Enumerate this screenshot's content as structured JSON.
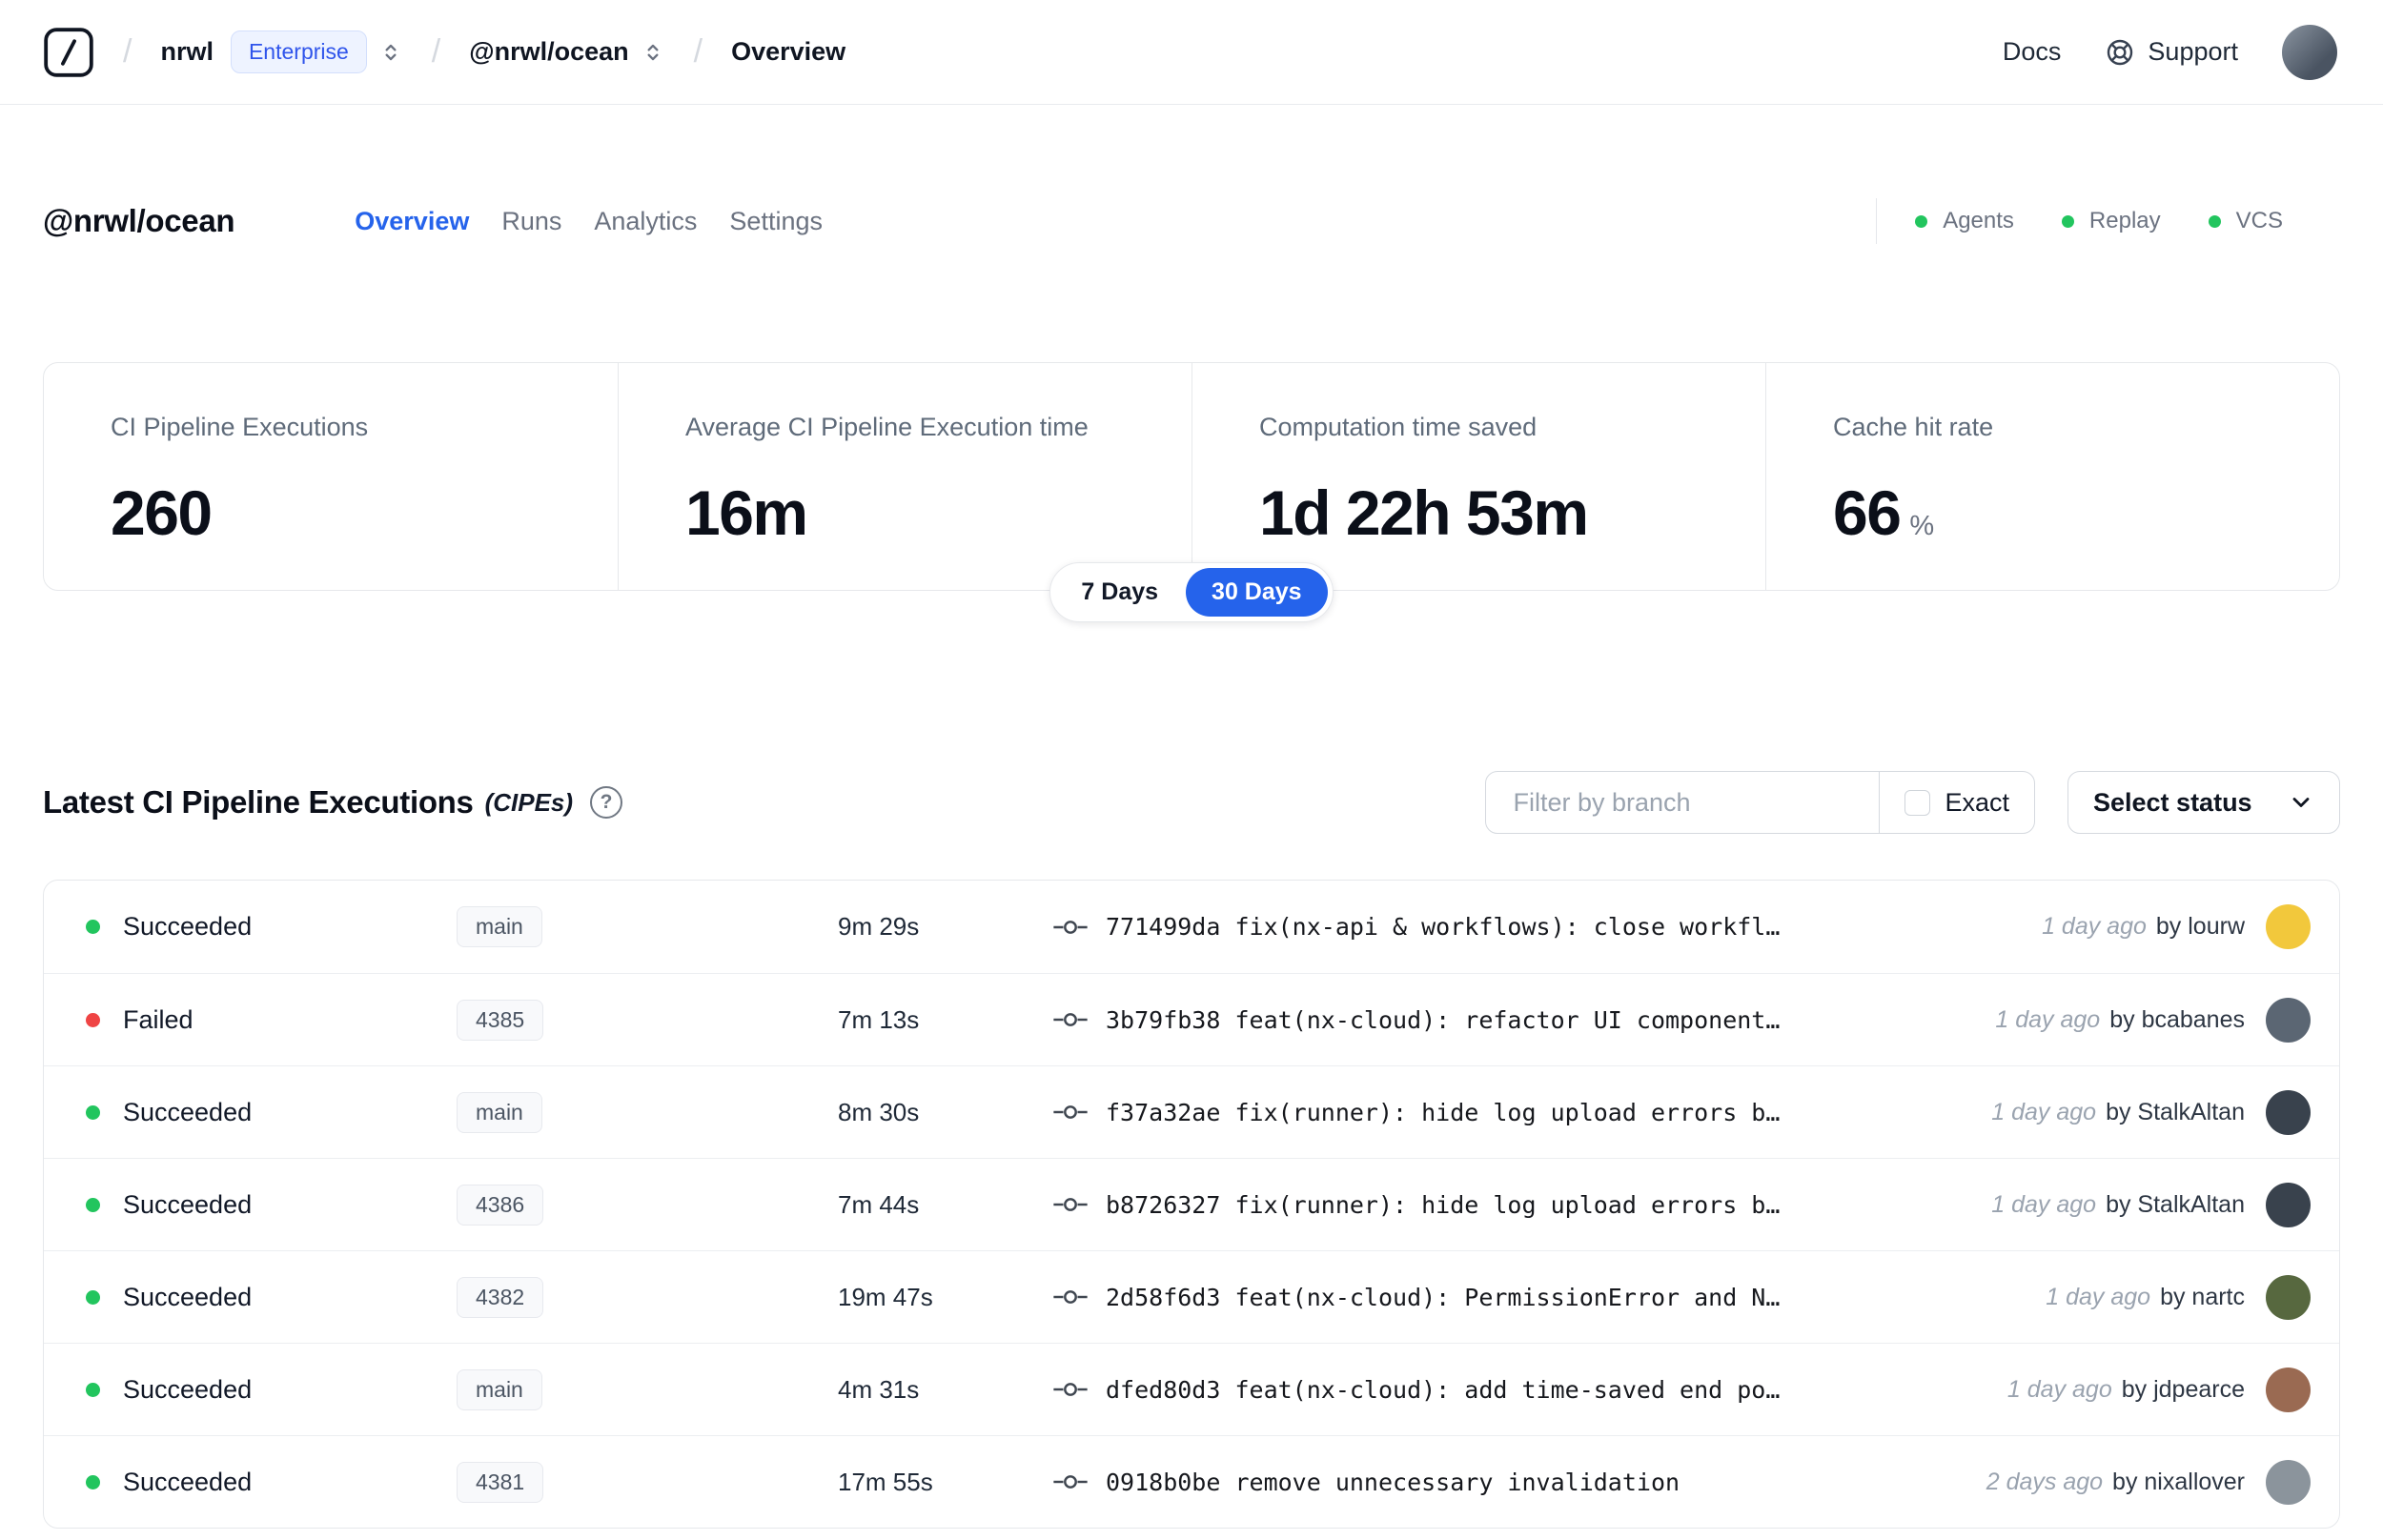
{
  "navbar": {
    "breadcrumb": {
      "org": "nrwl",
      "org_badge": "Enterprise",
      "workspace": "@nrwl/ocean",
      "page": "Overview"
    },
    "docs_label": "Docs",
    "support_label": "Support"
  },
  "header": {
    "title": "@nrwl/ocean",
    "tabs": [
      {
        "label": "Overview",
        "active": true
      },
      {
        "label": "Runs",
        "active": false
      },
      {
        "label": "Analytics",
        "active": false
      },
      {
        "label": "Settings",
        "active": false
      }
    ],
    "legend": [
      {
        "label": "Agents"
      },
      {
        "label": "Replay"
      },
      {
        "label": "VCS"
      }
    ],
    "legend_dot_color": "#22c55e"
  },
  "stats": {
    "cards": [
      {
        "label": "CI Pipeline Executions",
        "value": "260",
        "suffix": ""
      },
      {
        "label": "Average CI Pipeline Execution time",
        "value": "16m",
        "suffix": ""
      },
      {
        "label": "Computation time saved",
        "value": "1d 22h 53m",
        "suffix": ""
      },
      {
        "label": "Cache hit rate",
        "value": "66",
        "suffix": "%"
      }
    ],
    "range_toggle": [
      {
        "label": "7 Days",
        "active": false
      },
      {
        "label": "30 Days",
        "active": true
      }
    ],
    "accent_color": "#2563eb"
  },
  "cipes": {
    "title": "Latest CI Pipeline Executions",
    "title_suffix": "(CIPEs)",
    "help_glyph": "?",
    "filter_placeholder": "Filter by branch",
    "exact_label": "Exact",
    "status_select_label": "Select status",
    "rows": [
      {
        "status": "Succeeded",
        "status_color": "#22c55e",
        "branch": "main",
        "duration": "9m 29s",
        "commit": "771499da fix(nx-api & workflows): close workfl…",
        "time": "1 day ago",
        "author": "by lourw",
        "avatar_color": "#f2c83c"
      },
      {
        "status": "Failed",
        "status_color": "#ef4444",
        "branch": "4385",
        "duration": "7m 13s",
        "commit": "3b79fb38 feat(nx-cloud): refactor UI component…",
        "time": "1 day ago",
        "author": "by bcabanes",
        "avatar_color": "#5b6673"
      },
      {
        "status": "Succeeded",
        "status_color": "#22c55e",
        "branch": "main",
        "duration": "8m 30s",
        "commit": "f37a32ae fix(runner): hide log upload errors b…",
        "time": "1 day ago",
        "author": "by StalkAltan",
        "avatar_color": "#39424d"
      },
      {
        "status": "Succeeded",
        "status_color": "#22c55e",
        "branch": "4386",
        "duration": "7m 44s",
        "commit": "b8726327 fix(runner): hide log upload errors b…",
        "time": "1 day ago",
        "author": "by StalkAltan",
        "avatar_color": "#39424d"
      },
      {
        "status": "Succeeded",
        "status_color": "#22c55e",
        "branch": "4382",
        "duration": "19m 47s",
        "commit": "2d58f6d3 feat(nx-cloud): PermissionError and N…",
        "time": "1 day ago",
        "author": "by nartc",
        "avatar_color": "#57683f"
      },
      {
        "status": "Succeeded",
        "status_color": "#22c55e",
        "branch": "main",
        "duration": "4m 31s",
        "commit": "dfed80d3 feat(nx-cloud): add time-saved end po…",
        "time": "1 day ago",
        "author": "by jdpearce",
        "avatar_color": "#9a6a52"
      },
      {
        "status": "Succeeded",
        "status_color": "#22c55e",
        "branch": "4381",
        "duration": "17m 55s",
        "commit": "0918b0be remove unnecessary invalidation",
        "time": "2 days ago",
        "author": "by nixallover",
        "avatar_color": "#8b949c"
      }
    ]
  }
}
